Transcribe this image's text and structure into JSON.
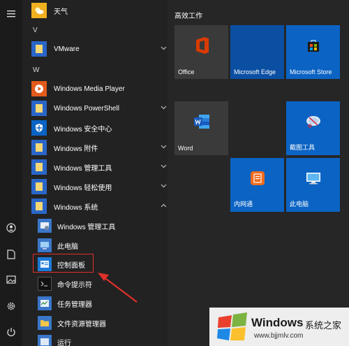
{
  "rail": {
    "items": [
      "menu",
      "user",
      "document",
      "pictures",
      "settings",
      "power"
    ]
  },
  "list": {
    "top_item": "天气",
    "letter_v": "V",
    "vmware": "VMware",
    "letter_w": "W",
    "apps": [
      "Windows Media Player",
      "Windows PowerShell",
      "Windows 安全中心",
      "Windows 附件",
      "Windows 管理工具",
      "Windows 轻松使用",
      "Windows 系统"
    ],
    "system_children": [
      "Windows 管理工具",
      "此电脑",
      "控制面板",
      "命令提示符",
      "任务管理器",
      "文件资源管理器",
      "运行"
    ]
  },
  "tiles": {
    "group_title": "高效工作",
    "items": [
      {
        "label": "Office",
        "icon": "office-icon"
      },
      {
        "label": "Microsoft Edge",
        "icon": "edge-icon"
      },
      {
        "label": "Microsoft Store",
        "icon": "store-icon"
      },
      {
        "label": "Word",
        "icon": "word-icon"
      },
      {
        "label": "截图工具",
        "icon": "snipping-icon"
      },
      {
        "label": "内网通",
        "icon": "neiwangtong-icon"
      },
      {
        "label": "此电脑",
        "icon": "this-pc-icon"
      }
    ]
  },
  "watermark": {
    "brand": "Windows",
    "cn": "系统之家",
    "url": "www.bjjmlv.com"
  },
  "colors": {
    "tile_blue": "#0b63c4",
    "tile_dark": "#3a3a3a",
    "highlight": "#e0302a"
  }
}
